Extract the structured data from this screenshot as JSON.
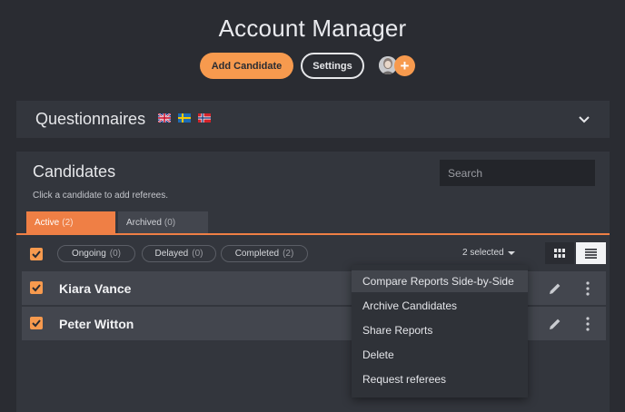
{
  "header": {
    "title": "Account Manager",
    "add_candidate_label": "Add Candidate",
    "settings_label": "Settings",
    "add_user_symbol": "+"
  },
  "questionnaires": {
    "title": "Questionnaires",
    "flags": [
      "uk-flag-icon",
      "sweden-flag-icon",
      "norway-flag-icon"
    ],
    "expand_icon": "chevron-down-icon"
  },
  "candidates": {
    "title": "Candidates",
    "subtitle": "Click a candidate to add referees.",
    "search_placeholder": "Search",
    "tabs": [
      {
        "label": "Active",
        "count": "(2)",
        "active": true
      },
      {
        "label": "Archived",
        "count": "(0)",
        "active": false
      }
    ],
    "filters": [
      {
        "label": "Ongoing",
        "count": "(0)"
      },
      {
        "label": "Delayed",
        "count": "(0)"
      },
      {
        "label": "Completed",
        "count": "(2)"
      }
    ],
    "selected_label": "2 selected",
    "view_modes": [
      "grid-view-icon",
      "list-view-icon"
    ],
    "active_view": "list",
    "rows": [
      {
        "name": "Kiara Vance",
        "checked": true
      },
      {
        "name": "Peter Witton",
        "checked": true
      }
    ]
  },
  "menu": {
    "items": [
      {
        "label": "Compare Reports Side-by-Side",
        "hover": true
      },
      {
        "label": "Archive Candidates"
      },
      {
        "label": "Share Reports"
      },
      {
        "label": "Delete"
      },
      {
        "label": "Request referees"
      }
    ]
  },
  "colors": {
    "accent": "#f79a4e",
    "tab_active": "#ef7f45",
    "background": "#2a2c32",
    "panel": "#33363d",
    "row": "#43464e"
  }
}
